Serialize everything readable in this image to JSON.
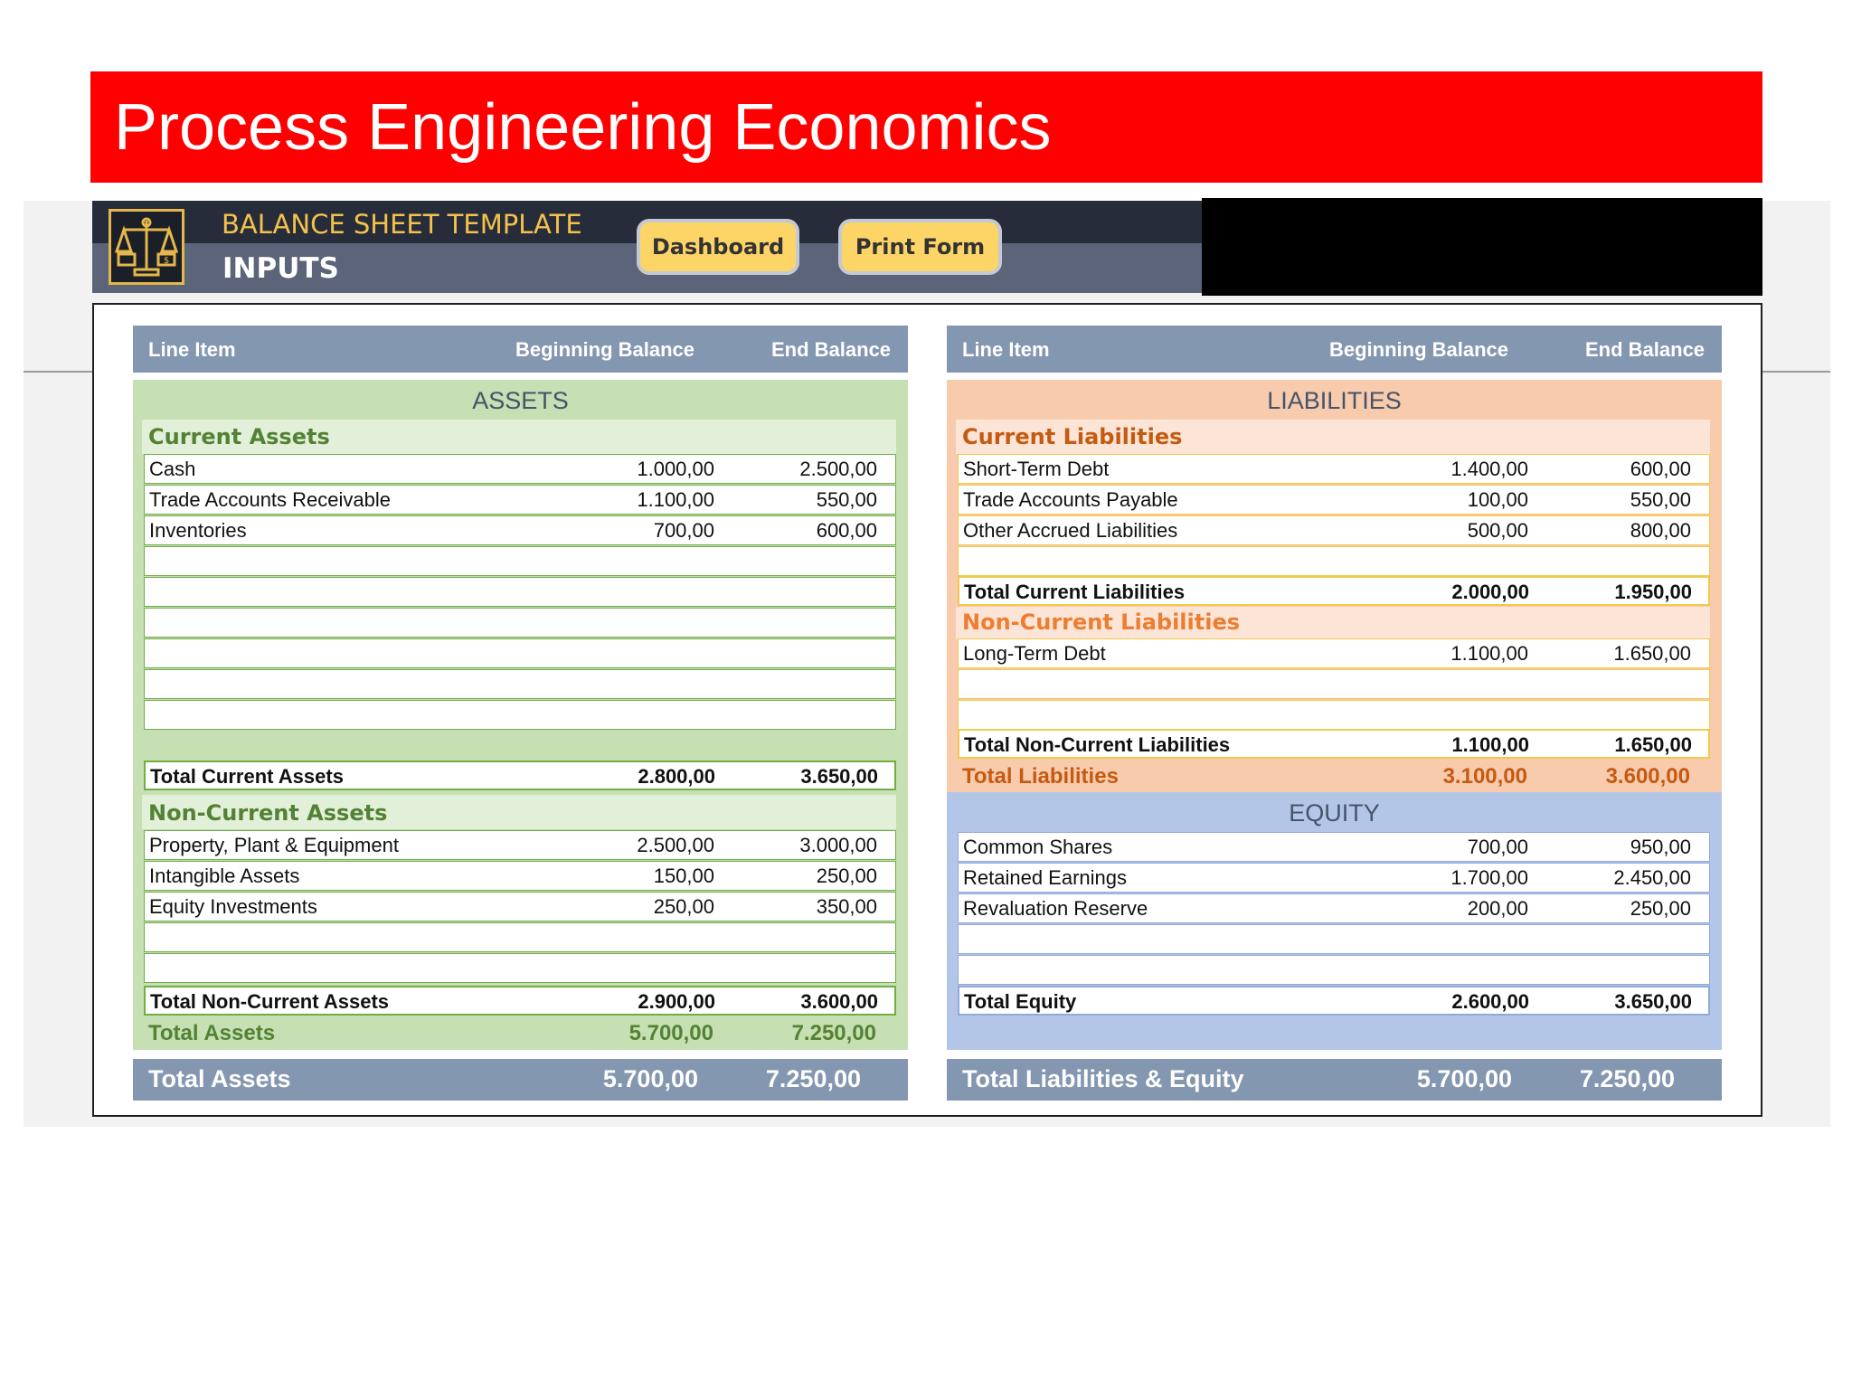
{
  "banner": {
    "title": "Process Engineering Economics"
  },
  "header": {
    "title": "BALANCE SHEET TEMPLATE",
    "subtitle": "INPUTS",
    "logo_icon": "balance-scale-icon",
    "buttons": {
      "dashboard": "Dashboard",
      "print_form": "Print Form"
    }
  },
  "columns": {
    "line_item": "Line Item",
    "beginning": "Beginning Balance",
    "end": "End Balance"
  },
  "colors": {
    "banner": "#ff0000",
    "assets_bg": "#c6dfb3",
    "liabilities_bg": "#f8cbad",
    "equity_bg": "#b4c6e7",
    "header_accent": "#f4c24c",
    "column_header": "#8497b0"
  },
  "assets": {
    "title": "ASSETS",
    "current": {
      "heading": "Current Assets",
      "rows": [
        {
          "item": "Cash",
          "begin": "1.000,00",
          "end": "2.500,00"
        },
        {
          "item": "Trade Accounts Receivable",
          "begin": "1.100,00",
          "end": "550,00"
        },
        {
          "item": "Inventories",
          "begin": "700,00",
          "end": "600,00"
        },
        {
          "item": "",
          "begin": "",
          "end": ""
        },
        {
          "item": "",
          "begin": "",
          "end": ""
        },
        {
          "item": "",
          "begin": "",
          "end": ""
        },
        {
          "item": "",
          "begin": "",
          "end": ""
        },
        {
          "item": "",
          "begin": "",
          "end": ""
        },
        {
          "item": "",
          "begin": "",
          "end": ""
        }
      ],
      "total": {
        "label": "Total Current Assets",
        "begin": "2.800,00",
        "end": "3.650,00"
      }
    },
    "noncurrent": {
      "heading": "Non-Current Assets",
      "rows": [
        {
          "item": "Property, Plant & Equipment",
          "begin": "2.500,00",
          "end": "3.000,00"
        },
        {
          "item": "Intangible Assets",
          "begin": "150,00",
          "end": "250,00"
        },
        {
          "item": "Equity Investments",
          "begin": "250,00",
          "end": "350,00"
        },
        {
          "item": "",
          "begin": "",
          "end": ""
        },
        {
          "item": "",
          "begin": "",
          "end": ""
        }
      ],
      "total": {
        "label": "Total Non-Current Assets",
        "begin": "2.900,00",
        "end": "3.600,00"
      }
    },
    "total": {
      "label": "Total Assets",
      "begin": "5.700,00",
      "end": "7.250,00"
    },
    "grand": {
      "label": "Total Assets",
      "begin": "5.700,00",
      "end": "7.250,00"
    }
  },
  "liabilities": {
    "title": "LIABILITIES",
    "current": {
      "heading": "Current Liabilities",
      "rows": [
        {
          "item": "Short-Term Debt",
          "begin": "1.400,00",
          "end": "600,00"
        },
        {
          "item": "Trade Accounts Payable",
          "begin": "100,00",
          "end": "550,00"
        },
        {
          "item": "Other Accrued Liabilities",
          "begin": "500,00",
          "end": "800,00"
        },
        {
          "item": "",
          "begin": "",
          "end": ""
        }
      ],
      "total": {
        "label": "Total Current Liabilities",
        "begin": "2.000,00",
        "end": "1.950,00"
      }
    },
    "noncurrent": {
      "heading": "Non-Current Liabilities",
      "rows": [
        {
          "item": "Long-Term Debt",
          "begin": "1.100,00",
          "end": "1.650,00"
        },
        {
          "item": "",
          "begin": "",
          "end": ""
        },
        {
          "item": "",
          "begin": "",
          "end": ""
        }
      ],
      "total": {
        "label": "Total Non-Current Liabilities",
        "begin": "1.100,00",
        "end": "1.650,00"
      }
    },
    "total": {
      "label": "Total Liabilities",
      "begin": "3.100,00",
      "end": "3.600,00"
    }
  },
  "equity": {
    "title": "EQUITY",
    "rows": [
      {
        "item": "Common Shares",
        "begin": "700,00",
        "end": "950,00"
      },
      {
        "item": "Retained Earnings",
        "begin": "1.700,00",
        "end": "2.450,00"
      },
      {
        "item": "Revaluation Reserve",
        "begin": "200,00",
        "end": "250,00"
      },
      {
        "item": "",
        "begin": "",
        "end": ""
      },
      {
        "item": "",
        "begin": "",
        "end": ""
      }
    ],
    "total": {
      "label": "Total Equity",
      "begin": "2.600,00",
      "end": "3.650,00"
    }
  },
  "grand_right": {
    "label": "Total Liabilities & Equity",
    "begin": "5.700,00",
    "end": "7.250,00"
  }
}
